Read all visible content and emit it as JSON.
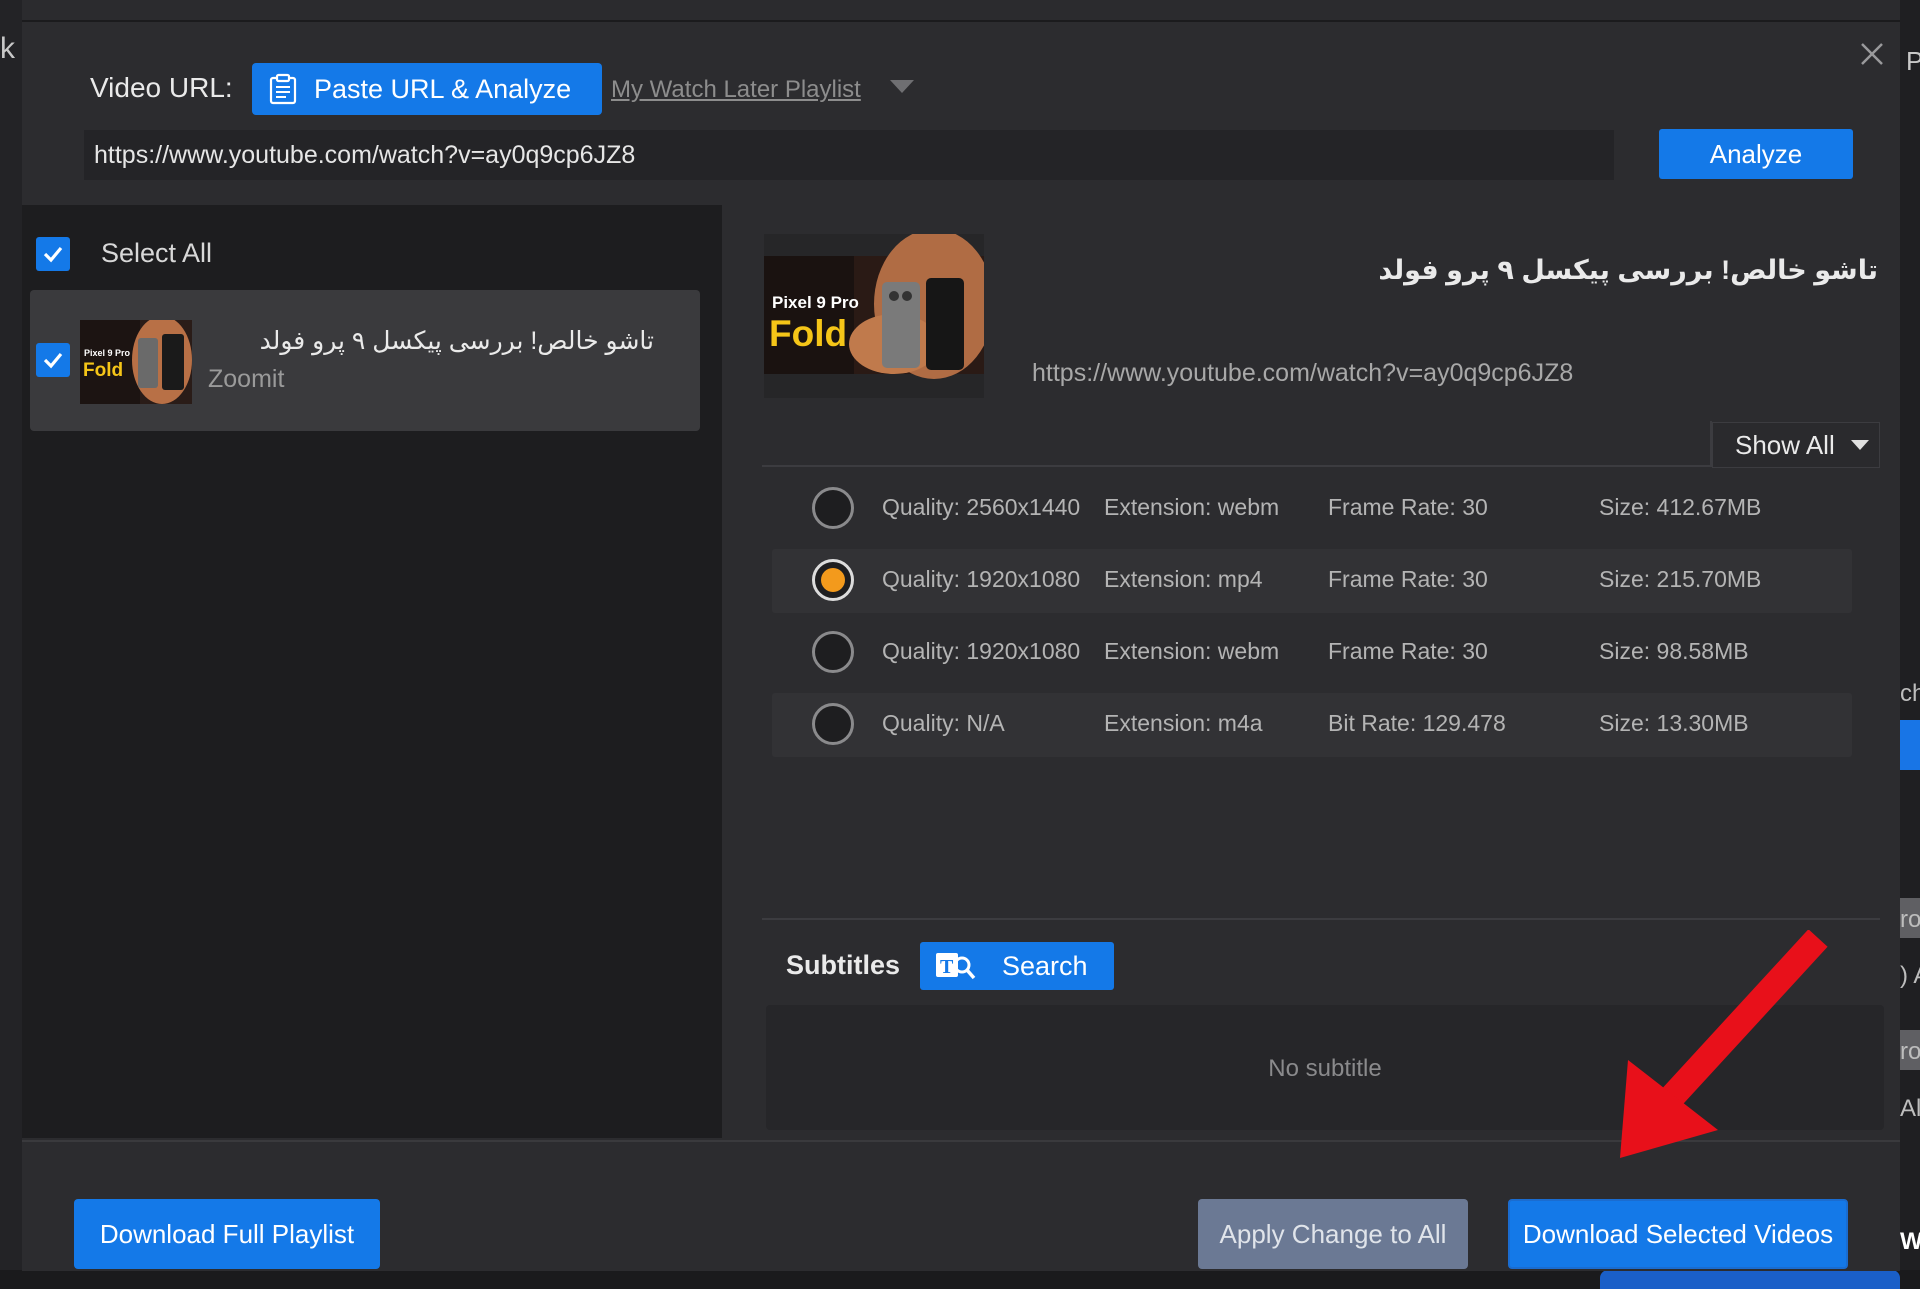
{
  "background_app": {
    "left_fragment": "k",
    "right_fragment_top": "P",
    "right_fragments": [
      "ch",
      "ro",
      ") A",
      "ro",
      "Al",
      "W"
    ]
  },
  "header": {
    "url_label": "Video URL:",
    "paste_button": "Paste URL & Analyze",
    "watch_later": "My Watch Later Playlist",
    "url_value": "https://www.youtube.com/watch?v=ay0q9cp6JZ8",
    "analyze_button": "Analyze"
  },
  "left": {
    "select_all": "Select All",
    "items": [
      {
        "title": "تاشو خالص! بررسی پیکسل ۹ پرو فولد",
        "channel": "Zoomit",
        "thumb_text_1": "Pixel 9 Pro",
        "thumb_text_2": "Fold"
      }
    ]
  },
  "detail": {
    "title": "تاشو خالص! بررسی پیکسل ۹ پرو فولد",
    "url": "https://www.youtube.com/watch?v=ay0q9cp6JZ8",
    "thumb_text_1": "Pixel 9 Pro",
    "thumb_text_2": "Fold",
    "filter": "Show All",
    "formats": [
      {
        "quality": "Quality: 2560x1440",
        "extension": "Extension: webm",
        "rate": "Frame Rate: 30",
        "size": "Size: 412.67MB",
        "selected": false
      },
      {
        "quality": "Quality: 1920x1080",
        "extension": "Extension: mp4",
        "rate": "Frame Rate: 30",
        "size": "Size: 215.70MB",
        "selected": true
      },
      {
        "quality": "Quality: 1920x1080",
        "extension": "Extension: webm",
        "rate": "Frame Rate: 30",
        "size": "Size: 98.58MB",
        "selected": false
      },
      {
        "quality": "Quality: N/A",
        "extension": "Extension: m4a",
        "rate": "Bit Rate: 129.478",
        "size": "Size: 13.30MB",
        "selected": false
      }
    ],
    "subtitles_label": "Subtitles",
    "search_button": "Search",
    "no_subtitle": "No subtitle"
  },
  "footer": {
    "download_full": "Download Full Playlist",
    "apply_all": "Apply Change to All",
    "download_selected": "Download Selected Videos"
  },
  "colors": {
    "accent": "#1479e8",
    "radio_selected": "#f39a1c",
    "annotation_arrow": "#e8101a"
  }
}
